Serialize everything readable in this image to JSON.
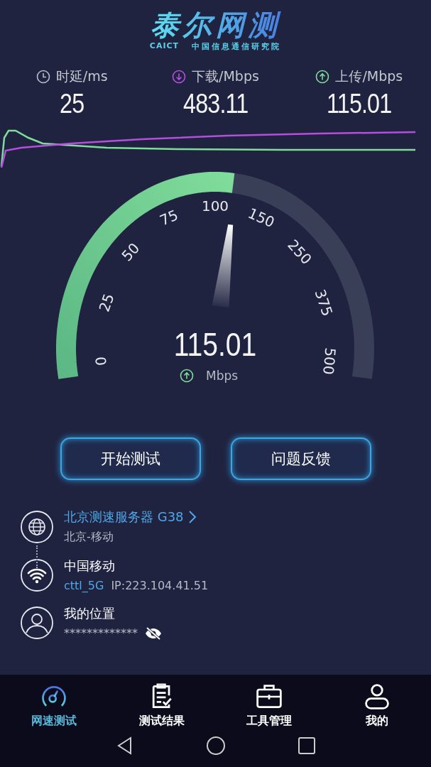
{
  "header": {
    "title": "泰尔网测",
    "org_short": "CAICT",
    "org_full": "中国信息通信研究院"
  },
  "metrics": [
    {
      "kind": "latency",
      "label": "时延/ms",
      "value": "25"
    },
    {
      "kind": "download",
      "label": "下载/Mbps",
      "value": "483.11"
    },
    {
      "kind": "upload",
      "label": "上传/Mbps",
      "value": "115.01"
    }
  ],
  "gauge": {
    "scale": [
      "0",
      "25",
      "50",
      "75",
      "100",
      "150",
      "250",
      "375",
      "500"
    ],
    "reading": "115.01",
    "kind": "upload",
    "unit": "Mbps"
  },
  "buttons": [
    {
      "label": "开始测试"
    },
    {
      "label": "问题反馈"
    }
  ],
  "info": [
    {
      "kind": "server",
      "title": "北京测速服务器 G38",
      "subtitle": "北京-移动"
    },
    {
      "kind": "network",
      "title": "中国移动",
      "ssid": "cttl_5G",
      "ip": "IP:223.104.41.51"
    },
    {
      "kind": "location",
      "title": "我的位置",
      "masked": "*************",
      "hidden": true
    }
  ],
  "tabs": [
    {
      "kind": "speed",
      "label": "网速测试",
      "selected": true
    },
    {
      "kind": "results",
      "label": "测试结果",
      "selected": false
    },
    {
      "kind": "tools",
      "label": "工具管理",
      "selected": false
    },
    {
      "kind": "me",
      "label": "我的",
      "selected": false
    }
  ]
}
